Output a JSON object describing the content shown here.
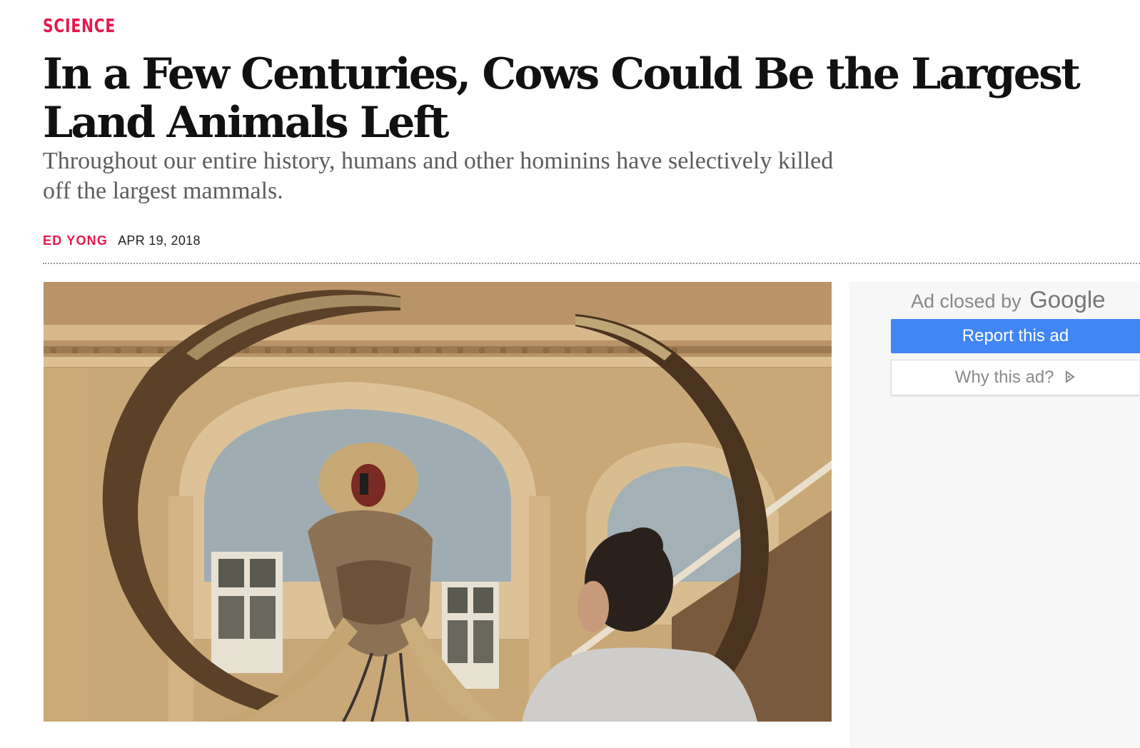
{
  "article": {
    "section": "SCIENCE",
    "headline": "In a Few Centuries, Cows Could Be the Largest Land Animals Left",
    "dek": "Throughout our entire history, humans and other hominins have selectively killed off the largest mammals.",
    "author": "ED YONG",
    "date": "APR 19, 2018"
  },
  "colors": {
    "accent": "#e5194b",
    "report_button": "#4285f4"
  },
  "ad": {
    "closed_prefix": "Ad closed by",
    "closed_brand": "Google",
    "report_label": "Report this ad",
    "why_label": "Why this ad?",
    "why_icon": "adchoices-icon"
  }
}
